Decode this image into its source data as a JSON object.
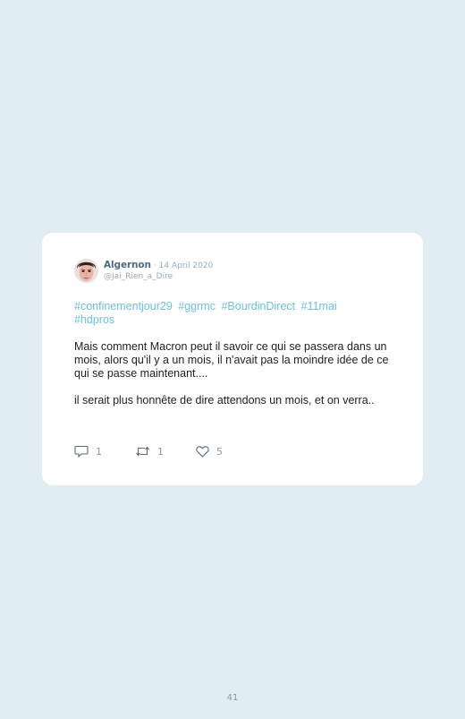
{
  "tweet": {
    "author_name": "Algernon",
    "date": "· 14 April 2020",
    "handle": "@Jai_Rien_a_Dire",
    "hashtags": [
      "#confinementjour29",
      "#ggrmc",
      "#BourdinDirect",
      "#11mai",
      "#hdpros"
    ],
    "paragraphs": [
      "Mais comment Macron peut il savoir ce qui se passera dans un mois, alors qu'il y a un mois, il n'avait pas la moindre idée de ce qui se passe maintenant....",
      "il serait plus honnête de dire attendons un mois, et on verra.."
    ],
    "actions": {
      "reply_count": "1",
      "retweet_count": "1",
      "like_count": "5"
    },
    "icons": {
      "avatar": "user-avatar",
      "reply": "reply-icon",
      "retweet": "retweet-icon",
      "like": "heart-icon"
    }
  },
  "page": {
    "number": "41"
  },
  "colors": {
    "background": "#e0eef4",
    "card": "#ffffff",
    "hashtag": "#6cc0e2",
    "name": "#4f6a7f",
    "muted": "#9aaab5"
  }
}
